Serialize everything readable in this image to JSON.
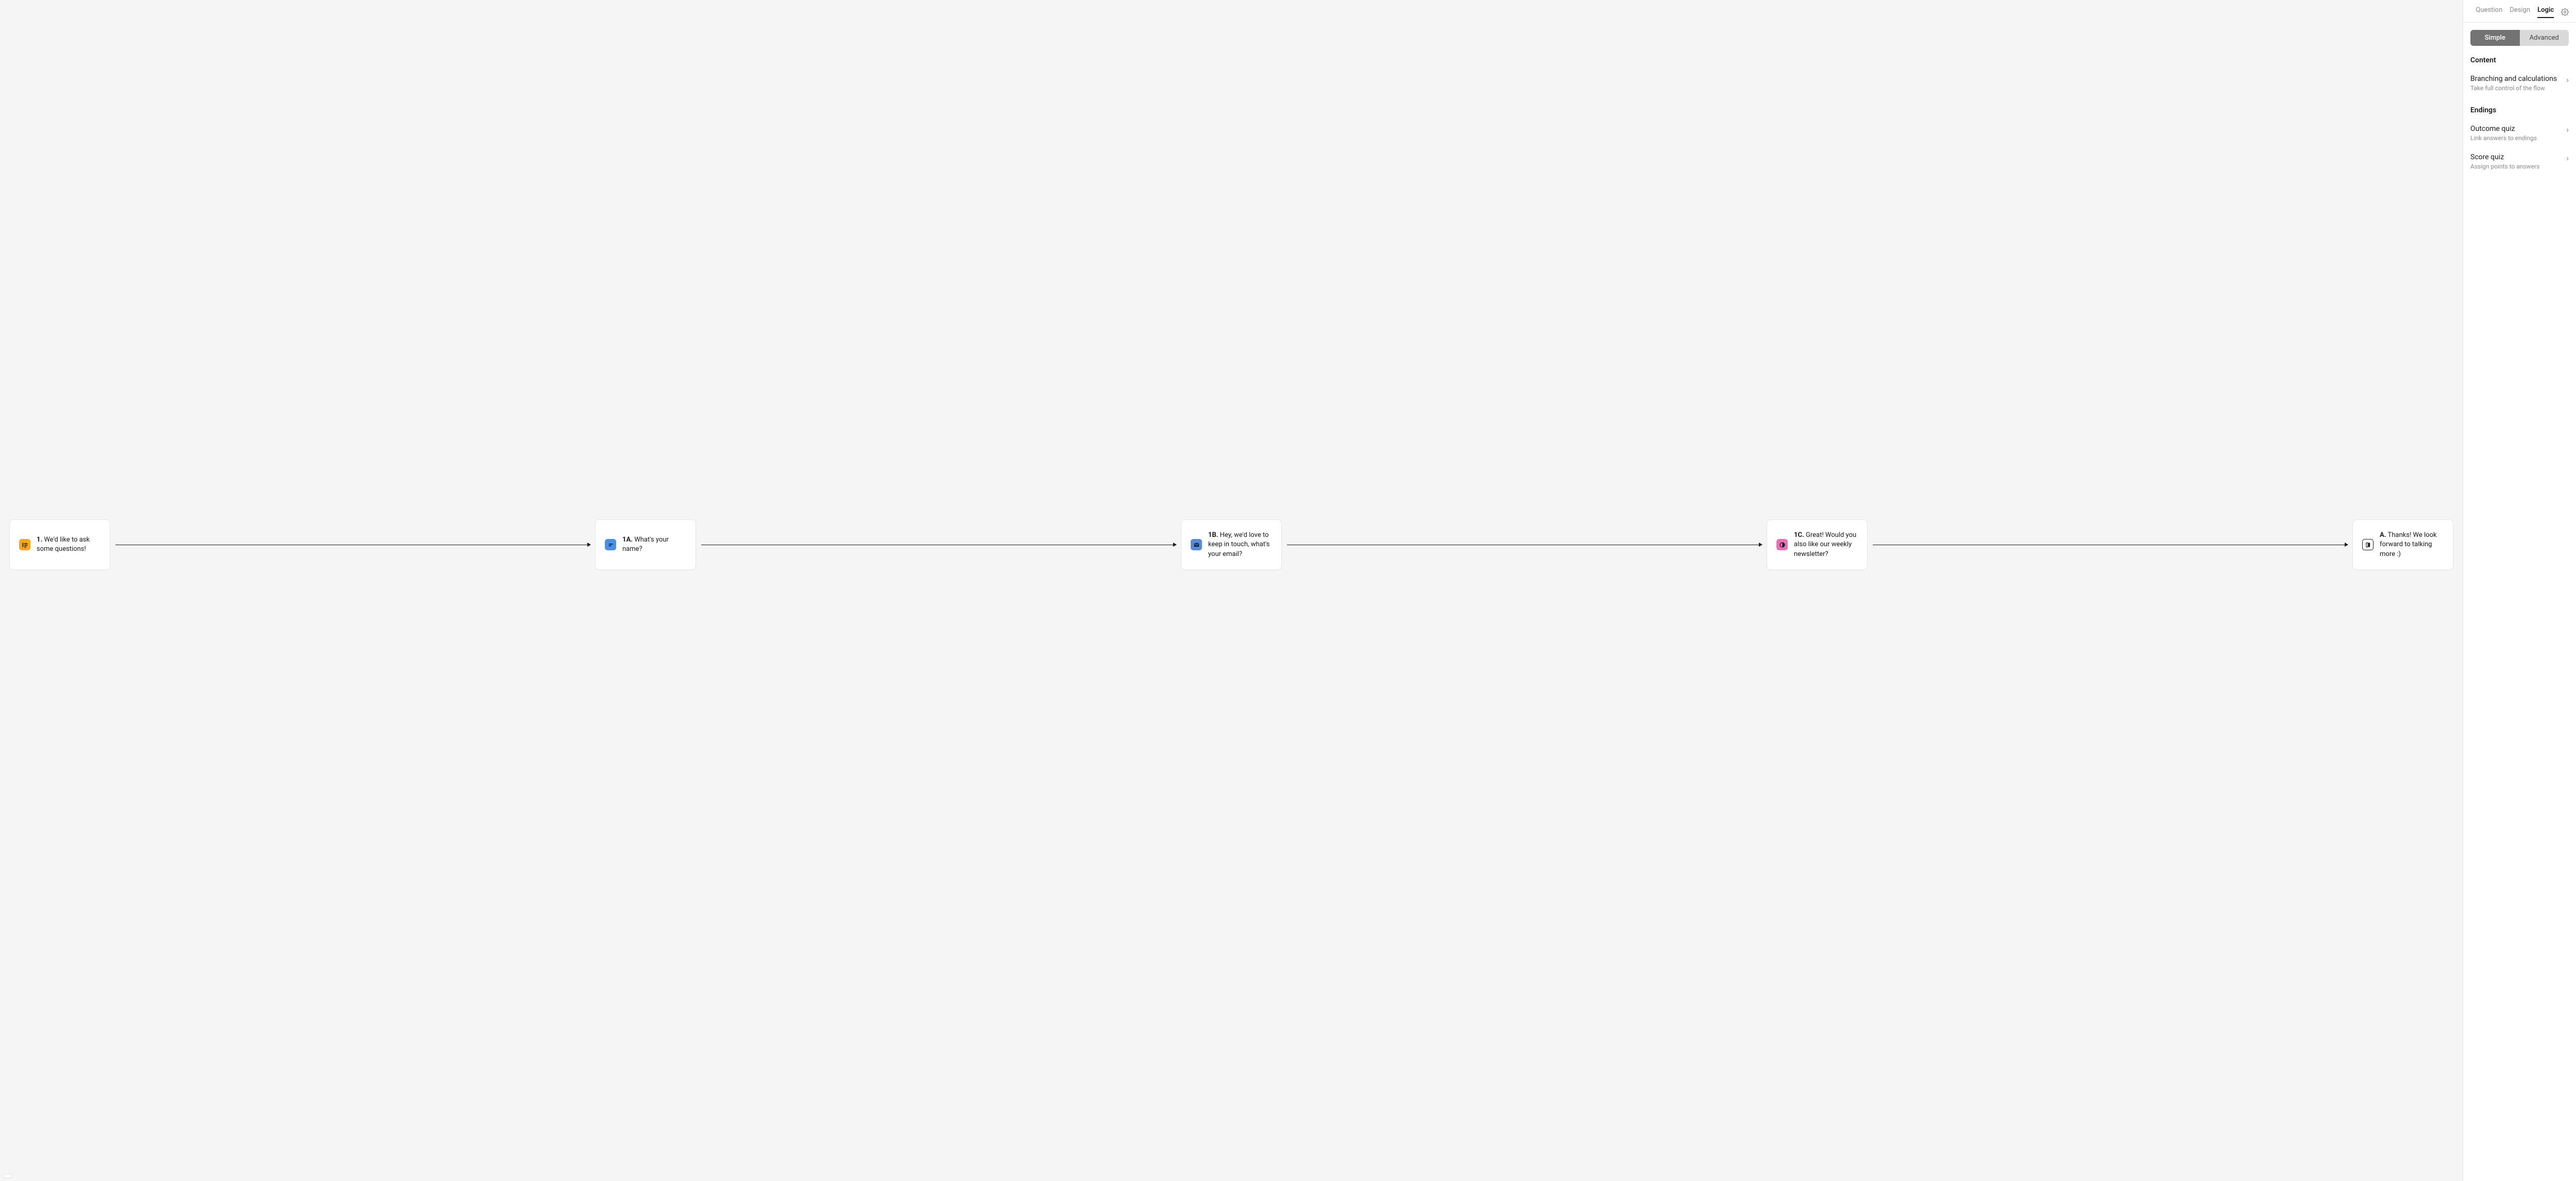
{
  "tabs": {
    "question": "Question",
    "design": "Design",
    "logic": "Logic"
  },
  "segment": {
    "simple": "Simple",
    "advanced": "Advanced"
  },
  "sections": {
    "content": "Content",
    "endings": "Endings"
  },
  "items": {
    "branching": {
      "label": "Branching and calculations",
      "desc": "Take full control of the flow"
    },
    "outcome": {
      "label": "Outcome quiz",
      "desc": "Link answers to endings"
    },
    "score": {
      "label": "Score quiz",
      "desc": "Assign points to answers"
    }
  },
  "nodes": {
    "n1": {
      "num": "1.",
      "text": "We'd like to ask some questions!"
    },
    "n1a": {
      "num": "1A.",
      "text": "What's your name?"
    },
    "n1b": {
      "num": "1B.",
      "text": "Hey, we'd love to keep in touch, what's your email?"
    },
    "n1c": {
      "num": "1C.",
      "text": "Great! Would you also like our weekly newsletter?"
    },
    "na": {
      "num": "A.",
      "text": "Thanks! We look forward to talking more :)"
    }
  }
}
